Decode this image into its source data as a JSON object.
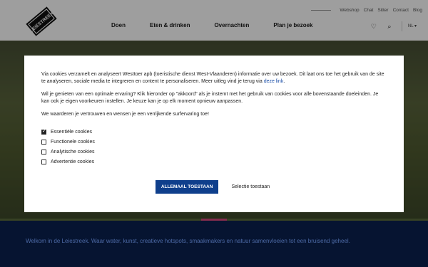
{
  "header": {
    "logo_text": "LEIESTREEK",
    "util_nav": [
      "Webshop",
      "Chat",
      "Sitter",
      "Contact",
      "Blog"
    ],
    "main_nav": [
      "Doen",
      "Eten & drinken",
      "Overnachten",
      "Plan je bezoek"
    ],
    "language": "NL",
    "icons": [
      "heart-icon",
      "search-icon"
    ]
  },
  "page": {
    "welcome_text": "Welkom in de Leiestreek. Waar water, kunst, creatieve hotspots, smaakmakers en natuur samenvloeien tot een bruisend geheel."
  },
  "cookie_dialog": {
    "intro_before_link": "Via cookies verzamelt en analyseert Westtoer apb (toeristische dienst West-Vlaanderen) informatie over uw bezoek. Dit laat ons toe het gebruik van de site te analyseren, sociale media te integreren en content te personaliseren. Meer uitleg vind je terug via ",
    "intro_link": "deze link",
    "intro_after_link": ".",
    "paragraph2": "Wil je genieten van een optimale ervaring? Klik hieronder op \"akkoord\" als je instemt met het gebruik van cookies voor alle bovenstaande doeleinden. Je kan ook je eigen voorkeuren instellen. Je keuze kan je op elk moment opnieuw aanpassen.",
    "paragraph3": "We waarderen je vertrouwen en wensen je een verrijkende surfervaring toe!",
    "options": [
      {
        "label": "Essentiële cookies",
        "checked": true
      },
      {
        "label": "Functionele cookies",
        "checked": false
      },
      {
        "label": "Analytische cookies",
        "checked": false
      },
      {
        "label": "Advertentie cookies",
        "checked": false
      }
    ],
    "accept_all_label": "ALLEMAAL TOESTAAN",
    "accept_selection_label": "Selectie toestaan"
  },
  "colors": {
    "primary_button": "#0f3f8c",
    "link": "#1b4fa8",
    "accent_pink": "#d4477d",
    "band_blue": "#0f2c6b"
  }
}
